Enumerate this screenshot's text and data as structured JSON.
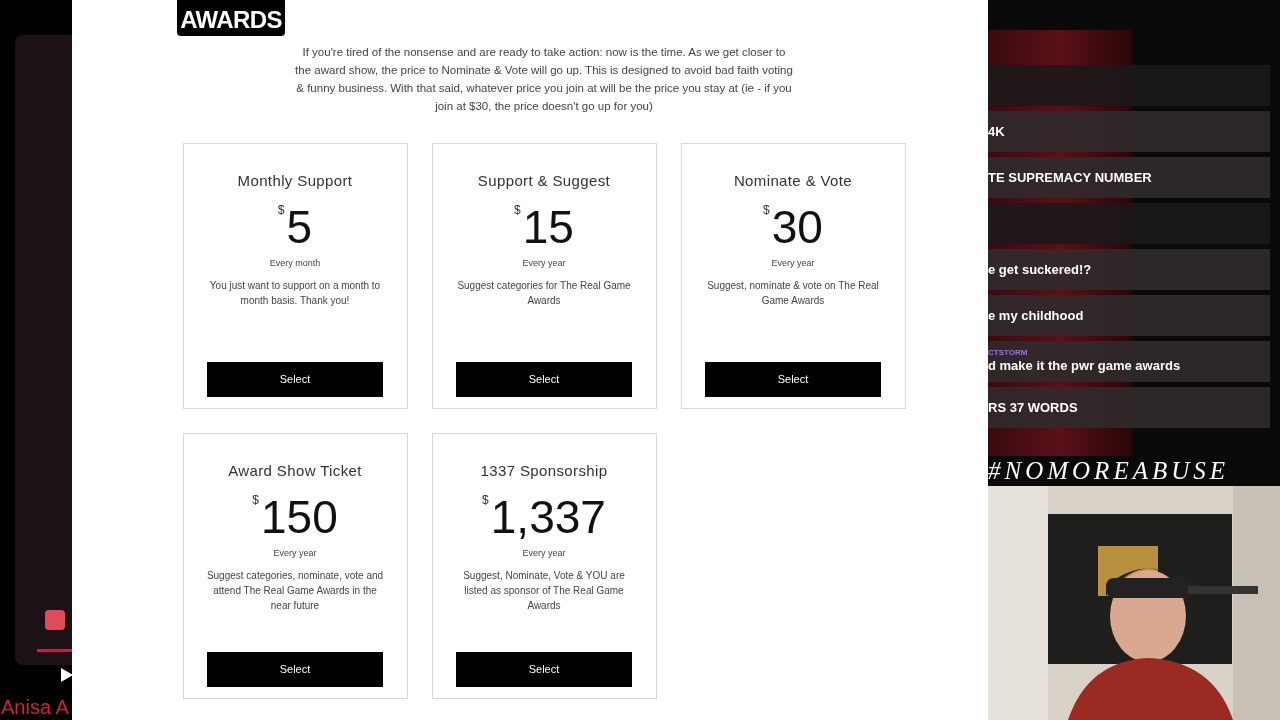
{
  "left_overlay": {
    "caption": "Anisa A"
  },
  "site": {
    "logo": "AWARDS",
    "intro": "If you're tired of the nonsense and are ready to take action: now is the time. As we get closer to the award show, the price to Nominate & Vote will go up. This is designed to avoid bad faith voting & funny business. With that said, whatever price you join at will be the price you stay at (ie - if you join at $30, the price doesn't go up for you)",
    "plans": [
      {
        "name": "Monthly Support",
        "currency": "$",
        "price": "5",
        "period": "Every month",
        "description": "You just want to support on a month to month basis. Thank you!",
        "button": "Select"
      },
      {
        "name": "Support & Suggest",
        "currency": "$",
        "price": "15",
        "period": "Every year",
        "description": "Suggest categories for The Real Game Awards",
        "button": "Select"
      },
      {
        "name": "Nominate & Vote",
        "currency": "$",
        "price": "30",
        "period": "Every year",
        "description": "Suggest, nominate & vote on The Real Game Awards",
        "button": "Select"
      },
      {
        "name": "Award Show Ticket",
        "currency": "$",
        "price": "150",
        "period": "Every year",
        "description": "Suggest categories, nominate, vote and attend The Real Game Awards in the near future",
        "button": "Select"
      },
      {
        "name": "1337 Sponsorship",
        "currency": "$",
        "price": "1,337",
        "period": "Every year",
        "description": "Suggest, Nominate, Vote & YOU are listed as sponsor of The Real Game Awards",
        "button": "Select"
      }
    ]
  },
  "chat": {
    "messages": [
      {
        "kind": "blank"
      },
      {
        "text": "4K"
      },
      {
        "text": "TE SUPREMACY NUMBER"
      },
      {
        "kind": "blank"
      },
      {
        "text": "e get suckered!?"
      },
      {
        "text": "e my childhood"
      },
      {
        "user": "CTSTORM",
        "text": "d make it the pwr game awards"
      },
      {
        "text": "RS 37 WORDS"
      }
    ],
    "hashtag": "#NOMOREABUSE"
  }
}
